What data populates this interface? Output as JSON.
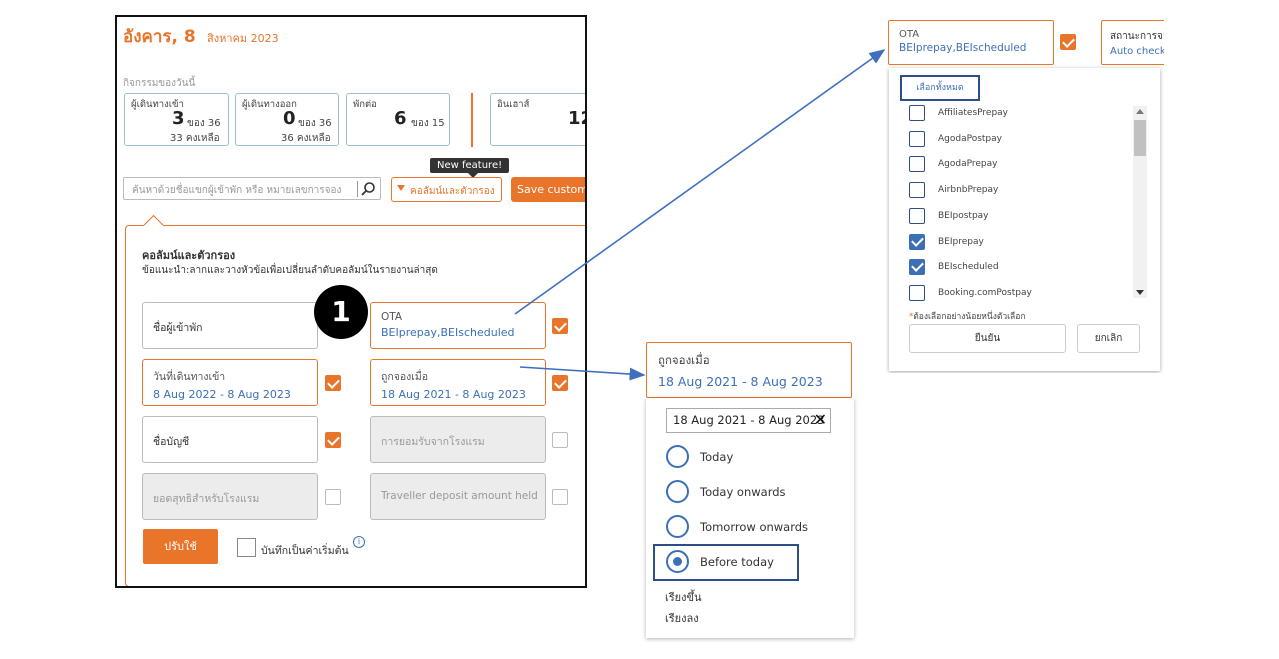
{
  "header": {
    "date_main": "อังคาร, 8",
    "date_sub": "สิงหาคม 2023",
    "today_label": "กิจกรรมของวันนี้"
  },
  "stats": [
    {
      "title": "ผู้เดินทางเข้า",
      "value": "3",
      "of": "ของ 36",
      "remaining": "33 คงเหลือ"
    },
    {
      "title": "ผู้เดินทางออก",
      "value": "0",
      "of": "ของ 36",
      "remaining": "36 คงเหลือ"
    },
    {
      "title": "พักต่อ",
      "value": "6",
      "of": "ของ 15",
      "remaining": ""
    },
    {
      "title": "อินเฮาส์",
      "value": "12",
      "of": "",
      "remaining": ""
    }
  ],
  "new_feature_tooltip": "New feature!",
  "search": {
    "placeholder": "ค้นหาด้วยชื่อแขกผู้เข้าพัก หรือ หมายเลขการจอง"
  },
  "toolbar": {
    "filter_label": "คอลัมน์และตัวกรอง",
    "save_label": "Save custom v"
  },
  "filter_panel": {
    "title": "คอลัมน์และตัวกรอง",
    "hint": "ข้อแนะนำ:ลากและวางหัวข้อเพื่อเปลี่ยนลำดับคอลัมน์ในรายงานล่าสุด",
    "fields": [
      {
        "label": "ชื่อผู้เข้าพัก",
        "value": ""
      },
      {
        "label": "OTA",
        "value": "BEIprepay,BEIscheduled",
        "checked": true
      },
      {
        "label": "วันที่เดินทางเข้า",
        "value": "8 Aug 2022 - 8 Aug 2023",
        "checked": true
      },
      {
        "label": "ถูกจองเมื่อ",
        "value": "18 Aug 2021 - 8 Aug 2023",
        "checked": true
      },
      {
        "label": "ชื่อบัญชี",
        "value": "",
        "checked": true
      },
      {
        "label": "การยอมรับจากโรงแรม",
        "value": "",
        "checked": false
      },
      {
        "label": "ยอดสุทธิสำหรับโรงแรม",
        "value": "",
        "checked": false
      },
      {
        "label": "Traveller deposit amount held",
        "value": "",
        "checked": false
      }
    ],
    "apply_label": "ปรับใช้",
    "save_default_label": "บันทึกเป็นค่าเริ่มต้น",
    "info_icon": "i"
  },
  "step_badge": "1",
  "date_popup": {
    "box_label": "ถูกจองเมื่อ",
    "box_value": "18 Aug 2021 - 8 Aug 2023",
    "input_value": "18 Aug 2021 - 8 Aug 2023",
    "clear_icon": "✕",
    "options": [
      "Today",
      "Today onwards",
      "Tomorrow onwards",
      "Before today"
    ],
    "selected": "Before today",
    "sort_asc": "เรียงขึ้น",
    "sort_desc": "เรียงลง"
  },
  "ota_popup": {
    "box_label": "OTA",
    "box_value": "BEIprepay,BEIscheduled",
    "status_label": "สถานะการจอ",
    "status_value": "Auto checke",
    "select_all": "เลือกทั้งหมด",
    "items": [
      {
        "label": "AffiliatesPrepay",
        "checked": false
      },
      {
        "label": "AgodaPostpay",
        "checked": false
      },
      {
        "label": "AgodaPrepay",
        "checked": false
      },
      {
        "label": "AirbnbPrepay",
        "checked": false
      },
      {
        "label": "BEIpostpay",
        "checked": false
      },
      {
        "label": "BEIprepay",
        "checked": true
      },
      {
        "label": "BEIscheduled",
        "checked": true
      },
      {
        "label": "Booking.comPostpay",
        "checked": false
      }
    ],
    "note_star": "*",
    "note": "ต้องเลือกอย่างน้อยหนึ่งตัวเลือก",
    "confirm_label": "ยืนยัน",
    "cancel_label": "ยกเลิก"
  },
  "colors": {
    "accent": "#e8752a",
    "link": "#3b6fb6",
    "highlight": "#2c4f8a"
  }
}
